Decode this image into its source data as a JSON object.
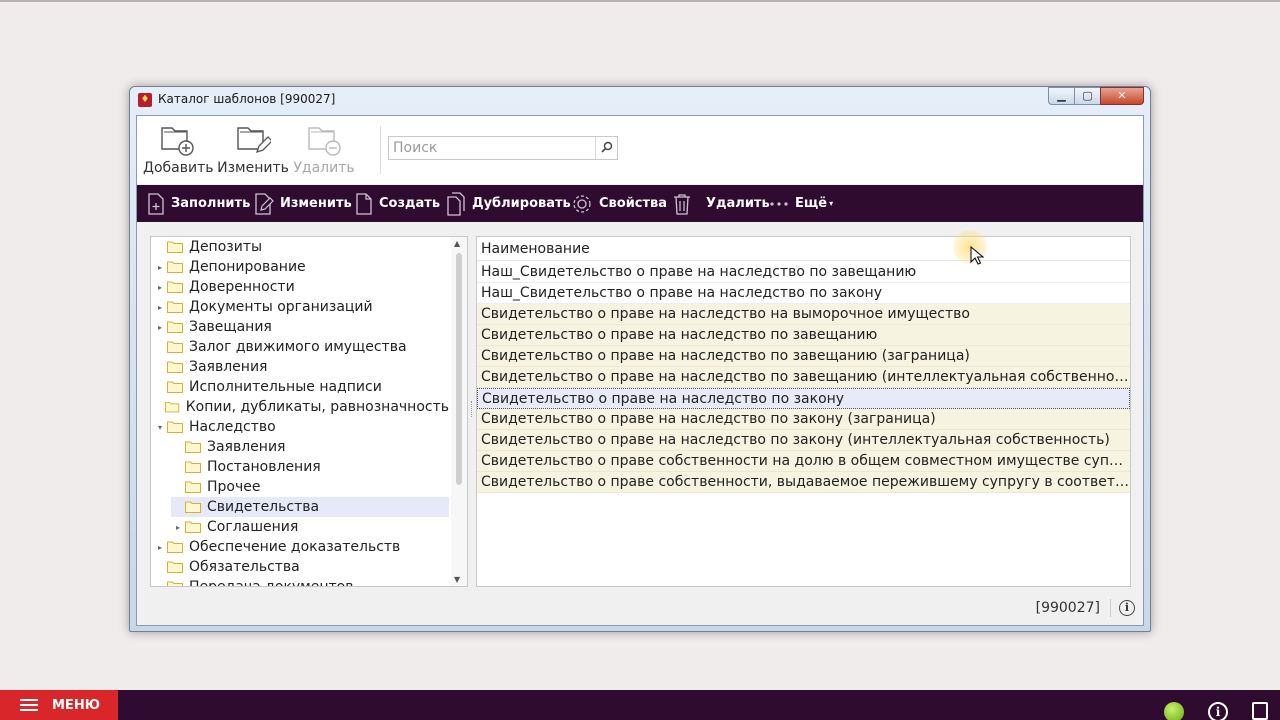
{
  "window": {
    "title": "Каталог шаблонов [990027]",
    "min_glyph": "▁",
    "max_glyph": "▢",
    "close_glyph": "✕"
  },
  "toolbar": {
    "add_label": "Добавить",
    "edit_label": "Изменить",
    "delete_label": "Удалить"
  },
  "search": {
    "placeholder": "Поиск"
  },
  "actions": {
    "fill": "Заполнить",
    "edit": "Изменить",
    "create": "Создать",
    "duplicate": "Дублировать",
    "properties": "Свойства",
    "delete": "Удалить",
    "more": "Ещё"
  },
  "tree": {
    "items": [
      {
        "label": "Депозиты",
        "level": 0,
        "expander": ""
      },
      {
        "label": "Депонирование",
        "level": 0,
        "expander": "▸"
      },
      {
        "label": "Доверенности",
        "level": 0,
        "expander": "▸"
      },
      {
        "label": "Документы организаций",
        "level": 0,
        "expander": "▸"
      },
      {
        "label": "Завещания",
        "level": 0,
        "expander": "▸"
      },
      {
        "label": "Залог движимого имущества",
        "level": 0,
        "expander": ""
      },
      {
        "label": "Заявления",
        "level": 0,
        "expander": ""
      },
      {
        "label": "Исполнительные надписи",
        "level": 0,
        "expander": ""
      },
      {
        "label": "Копии, дубликаты, равнозначность",
        "level": 0,
        "expander": ""
      },
      {
        "label": "Наследство",
        "level": 0,
        "expander": "▾"
      },
      {
        "label": "Заявления",
        "level": 1,
        "expander": ""
      },
      {
        "label": "Постановления",
        "level": 1,
        "expander": ""
      },
      {
        "label": "Прочее",
        "level": 1,
        "expander": ""
      },
      {
        "label": "Свидетельства",
        "level": 1,
        "expander": "",
        "selected": true
      },
      {
        "label": "Соглашения",
        "level": 1,
        "expander": "▸"
      },
      {
        "label": "Обеспечение доказательств",
        "level": 0,
        "expander": "▸"
      },
      {
        "label": "Обязательства",
        "level": 0,
        "expander": ""
      },
      {
        "label": "Передача документов",
        "level": 0,
        "expander": "▸"
      }
    ]
  },
  "list": {
    "header": "Наименование",
    "rows": [
      {
        "text": "Наш_Свидетельство о праве на наследство по завещанию",
        "style": "white"
      },
      {
        "text": "Наш_Свидетельство о праве на наследство по закону",
        "style": "white"
      },
      {
        "text": "Свидетельство о праве на наследство на выморочное имущество",
        "style": "yellow"
      },
      {
        "text": "Свидетельство о праве на наследство по завещанию",
        "style": "yellow"
      },
      {
        "text": "Свидетельство о праве на наследство по завещанию (заграница)",
        "style": "yellow"
      },
      {
        "text": "Свидетельство о праве на наследство по завещанию (интеллектуальная собственность)",
        "style": "yellow"
      },
      {
        "text": "Свидетельство о праве на наследство по закону",
        "style": "selected"
      },
      {
        "text": "Свидетельство о праве на наследство по закону (заграница)",
        "style": "yellow"
      },
      {
        "text": "Свидетельство о праве на наследство по закону (интеллектуальная собственность)",
        "style": "yellow"
      },
      {
        "text": "Свидетельство о праве собственности на долю в общем совместном имуществе супругов...",
        "style": "yellow"
      },
      {
        "text": "Свидетельство о праве собственности, выдаваемое пережившему супругу в соответстви...",
        "style": "yellow"
      }
    ]
  },
  "status": {
    "code": "[990027]",
    "info_glyph": "i"
  },
  "taskbar": {
    "menu_label": "МЕНЮ",
    "info_glyph": "i"
  },
  "colors": {
    "accent_dark": "#2f0b2f",
    "menu_red": "#d8262b",
    "row_yellow": "#f6f3e0"
  }
}
